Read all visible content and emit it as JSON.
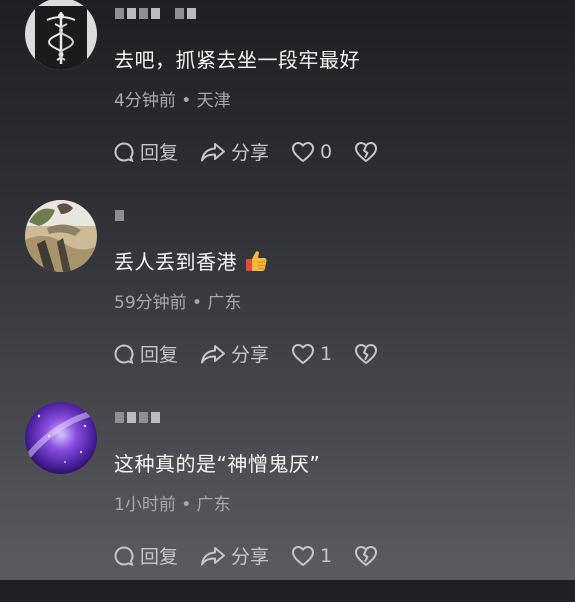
{
  "comments": [
    {
      "content": "去吧，抓紧去坐一段牢最好",
      "time": "4分钟前",
      "location": "天津",
      "reply_label": "回复",
      "share_label": "分享",
      "likes": "0",
      "emoji": ""
    },
    {
      "content": "丢人丢到香港",
      "time": "59分钟前",
      "location": "广东",
      "reply_label": "回复",
      "share_label": "分享",
      "likes": "1",
      "emoji": "thumbs-up"
    },
    {
      "content": "这种真的是“神憎鬼厌”",
      "time": "1小时前",
      "location": "广东",
      "reply_label": "回复",
      "share_label": "分享",
      "likes": "1",
      "emoji": ""
    }
  ],
  "meta_separator": " • ",
  "icons": {
    "reply": "comment-bubble-icon",
    "share": "share-arrow-icon",
    "like": "heart-icon",
    "dislike": "broken-heart-icon"
  }
}
